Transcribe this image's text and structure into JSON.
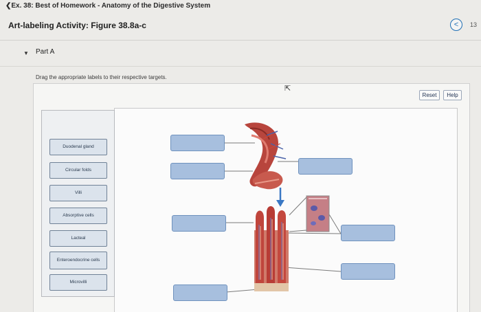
{
  "header": {
    "breadcrumb": "❮Ex. 38: Best of Homework - Anatomy of the Digestive System",
    "title": "Art-labeling Activity: Figure 38.8a-c",
    "nav_prev_glyph": "<",
    "page_count": "13"
  },
  "part": {
    "caret": "▼",
    "label": "Part A"
  },
  "instructions": "Drag the appropriate labels to their respective targets.",
  "toolbar": {
    "reset_label": "Reset",
    "help_label": "Help"
  },
  "labels": [
    "Duodenal gland",
    "Circular folds",
    "Villi",
    "Absorptive cells",
    "Lacteal",
    "Enteroendocrine cells",
    "Microvilli"
  ],
  "drop_targets_count": 7,
  "colors": {
    "target_fill": "#a7bfde",
    "target_border": "#6e91bd",
    "label_fill": "#dbe3ec",
    "accent": "#1f6fb5"
  }
}
